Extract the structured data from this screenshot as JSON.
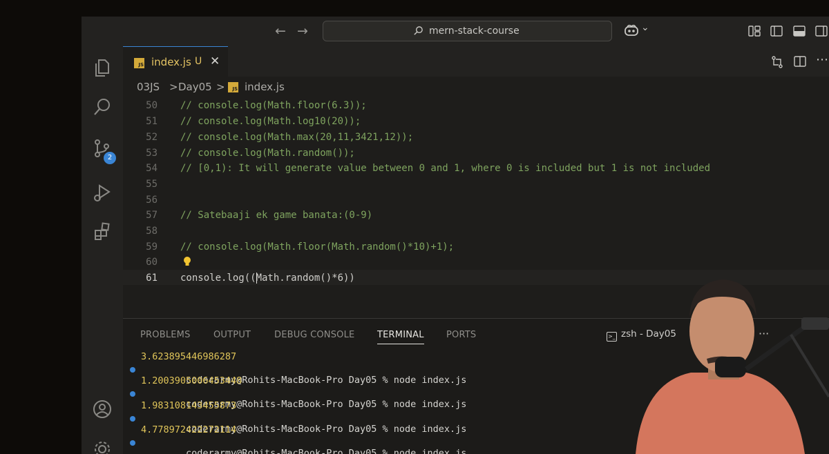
{
  "titlebar": {
    "search_text": "mern-stack-course",
    "copilot_label": "⌄"
  },
  "activity_bar": {
    "scm_badge": "2",
    "icons": [
      "explorer-icon",
      "search-icon",
      "source-control-icon",
      "run-debug-icon",
      "extensions-icon",
      "account-icon",
      "manage-gear-icon"
    ]
  },
  "tab": {
    "name": "index.js",
    "modified": "U",
    "close": "✕",
    "icon_text": "JS"
  },
  "breadcrumb": {
    "parts": [
      "03JS",
      "Day05",
      "index.js"
    ],
    "separator": ">"
  },
  "editor": {
    "lines": [
      {
        "num": "50",
        "code": "// console.log(Math.floor(6.3));"
      },
      {
        "num": "51",
        "code": "// console.log(Math.log10(20));"
      },
      {
        "num": "52",
        "code": "// console.log(Math.max(20,11,3421,12));"
      },
      {
        "num": "53",
        "code": "// console.log(Math.random());"
      },
      {
        "num": "54",
        "code": "// [0,1): It will generate value between 0 and 1, where 0 is included but 1 is not included"
      },
      {
        "num": "55",
        "code": ""
      },
      {
        "num": "56",
        "code": ""
      },
      {
        "num": "57",
        "code": "// Satebaaji ek game banata:(0-9)"
      },
      {
        "num": "58",
        "code": ""
      },
      {
        "num": "59",
        "code": "// console.log(Math.floor(Math.random()*10)+1);"
      },
      {
        "num": "60",
        "code": ""
      },
      {
        "num": "61",
        "code": "console.log((Math.random()*6))"
      }
    ]
  },
  "panel": {
    "tabs": [
      "PROBLEMS",
      "OUTPUT",
      "DEBUG CONSOLE",
      "TERMINAL",
      "PORTS"
    ],
    "active_tab": "TERMINAL",
    "terminal_title": "zsh - Day05",
    "more": "···",
    "terminal_lines": [
      {
        "type": "out",
        "text": "3.623895446986287"
      },
      {
        "type": "prompt",
        "text": "coderarmy@Rohits-MacBook-Pro Day05 % node index.js"
      },
      {
        "type": "out",
        "text": "1.2003905006453448"
      },
      {
        "type": "prompt",
        "text": "coderarmy@Rohits-MacBook-Pro Day05 % node index.js"
      },
      {
        "type": "out",
        "text": "1.983108143455873"
      },
      {
        "type": "prompt",
        "text": "coderarmy@Rohits-MacBook-Pro Day05 % node index.js"
      },
      {
        "type": "out",
        "text": "4.778972422272114"
      },
      {
        "type": "prompt",
        "text": "coderarmy@Rohits-MacBook-Pro Day05 % node index.js"
      }
    ]
  },
  "colors": {
    "accent": "#3a85d5",
    "comment": "#7fa45f",
    "output": "#e1c65a",
    "js_icon": "#d4aa3a"
  }
}
